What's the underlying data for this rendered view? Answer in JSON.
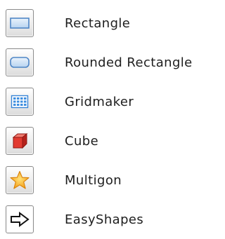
{
  "items": [
    {
      "id": "rectangle",
      "label": "Rectangle",
      "icon": "rectangle-icon"
    },
    {
      "id": "rounded-rectangle",
      "label": "Rounded Rectangle",
      "icon": "rounded-rectangle-icon"
    },
    {
      "id": "gridmaker",
      "label": "Gridmaker",
      "icon": "grid-icon"
    },
    {
      "id": "cube",
      "label": "Cube",
      "icon": "cube-icon"
    },
    {
      "id": "multigon",
      "label": "Multigon",
      "icon": "star-icon"
    },
    {
      "id": "easyshapes",
      "label": "EasyShapes",
      "icon": "arrow-right-icon"
    }
  ],
  "colors": {
    "shape_blue_fill": "#cfe3f7",
    "shape_blue_stroke": "#5b8fc9",
    "cube_red": "#d9302a",
    "star_orange": "#f6a623",
    "text": "#1e1e1e"
  }
}
